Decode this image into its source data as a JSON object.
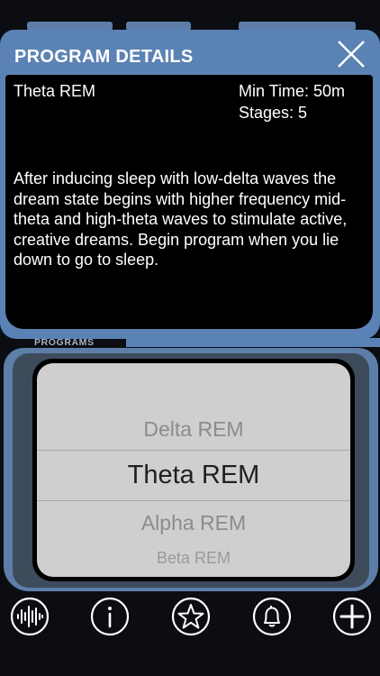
{
  "modal": {
    "title": "PROGRAM DETAILS",
    "close_icon": "close-icon",
    "program_name": "Theta REM",
    "min_time": "Min Time: 50m",
    "stages": "Stages: 5",
    "description": "After inducing sleep with low-delta waves the dream state begins with higher frequency mid-theta and high-theta waves to stimulate active, creative dreams.  Begin program when you lie down to go to sleep."
  },
  "programs": {
    "label": "PROGRAMS",
    "items": [
      "Delta REM",
      "Theta REM",
      "Alpha REM",
      "Beta REM"
    ],
    "selected": "Theta REM"
  },
  "toolbar": {
    "icons": [
      "waveform-icon",
      "info-icon",
      "star-icon",
      "bell-icon",
      "plus-icon"
    ]
  },
  "colors": {
    "accent_blue": "#5b82b4",
    "panel_black": "#000000",
    "picker_gray": "#cfcfcf"
  }
}
